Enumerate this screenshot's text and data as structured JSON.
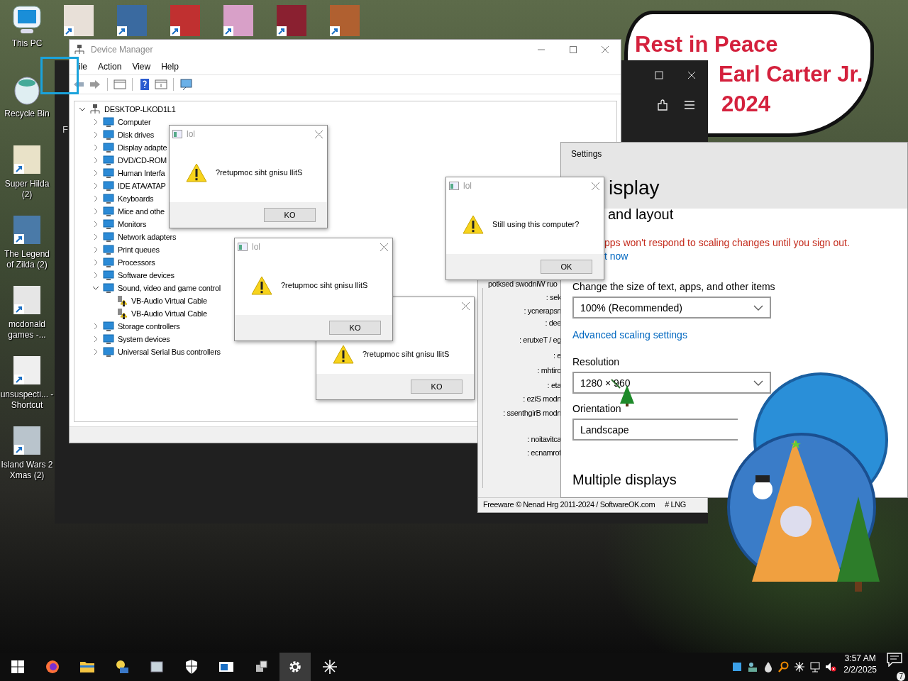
{
  "desktop_icons": [
    {
      "label": "This PC"
    },
    {
      "label": "Recycle Bin"
    },
    {
      "label": "Super Hilda (2)"
    },
    {
      "label": "The Legend of Zilda (2)"
    },
    {
      "label": "mcdonald games -..."
    },
    {
      "label": "unsuspecti... - Shortcut"
    },
    {
      "label": "Island Wars 2 Xmas (2)"
    }
  ],
  "banner": {
    "lines": [
      "Rest in Peace",
      "Earl Carter Jr.",
      "2024"
    ]
  },
  "background_window": {
    "label": "F"
  },
  "device_manager": {
    "title": "Device Manager",
    "menu": [
      "ile",
      "Action",
      "View",
      "Help"
    ],
    "tree": {
      "label": "DESKTOP-LKOD1L1",
      "expanded": true,
      "children": [
        {
          "label": "Computer",
          "expanded": false
        },
        {
          "label": "Disk drives",
          "expanded": false
        },
        {
          "label": "Display adapte",
          "expanded": false
        },
        {
          "label": "DVD/CD-ROM",
          "expanded": false
        },
        {
          "label": "Human Interfa",
          "expanded": false
        },
        {
          "label": "IDE ATA/ATAP",
          "expanded": false
        },
        {
          "label": "Keyboards",
          "expanded": false
        },
        {
          "label": "Mice and othe",
          "expanded": false
        },
        {
          "label": "Monitors",
          "expanded": false
        },
        {
          "label": "Network adapters",
          "expanded": false
        },
        {
          "label": "Print queues",
          "expanded": false
        },
        {
          "label": "Processors",
          "expanded": false
        },
        {
          "label": "Software devices",
          "expanded": false
        },
        {
          "label": "Sound, video and game control",
          "expanded": true,
          "children": [
            {
              "label": "VB-Audio Virtual Cable",
              "warning": true
            },
            {
              "label": "VB-Audio Virtual Cable",
              "warning": true
            }
          ]
        },
        {
          "label": "Storage controllers",
          "expanded": false
        },
        {
          "label": "System devices",
          "expanded": false
        },
        {
          "label": "Universal Serial Bus controllers",
          "expanded": false
        }
      ]
    }
  },
  "tool_window": {
    "header": "potksed swodniW ruo",
    "labels": [
      ": sek",
      ": ycnerapsn",
      ": dee",
      ": erutxeT / eg",
      ": e",
      ": mhtiro",
      ": eta",
      ": eziS modn",
      ": ssenthgirB modn",
      ": noitavitca",
      ": ecnamrof"
    ],
    "footer": "Freeware © Nenad Hrg 2011-2024 / SoftwareOK.com",
    "language": "# LNG"
  },
  "settings": {
    "title": "Settings",
    "heading": "isplay",
    "subheading": "and layout",
    "notice": "pps won't respond to scaling changes until you sign out.",
    "notice_link": "t now",
    "scale_label": "Change the size of text, apps, and other items",
    "scale_value": "100% (Recommended)",
    "advanced_link": "Advanced scaling settings",
    "resolution_label": "Resolution",
    "resolution_value": "1280 × 960",
    "orientation_label": "Orientation",
    "orientation_value": "Landscape",
    "section": "Multiple displays"
  },
  "dialogs": [
    {
      "message": "?retupmoc siht gnisu llitS",
      "button": "KO"
    },
    {
      "title": "lol",
      "message": "?retupmoc siht gnisu llitS",
      "button": "KO"
    },
    {
      "title": "lol",
      "message": "?retupmoc siht gnisu llitS",
      "button": "KO"
    },
    {
      "title": "lol",
      "message": "Still using this computer?",
      "button": "OK"
    }
  ],
  "taskbar": {
    "apps": [
      {
        "selected": false
      },
      {
        "selected": false
      },
      {
        "selected": false
      },
      {
        "selected": false
      },
      {
        "selected": false
      },
      {
        "selected": false
      },
      {
        "selected": false
      },
      {
        "selected": true
      },
      {
        "selected": false
      }
    ],
    "time": "3:57 AM",
    "date": "2/2/2025",
    "notifications": "7"
  }
}
